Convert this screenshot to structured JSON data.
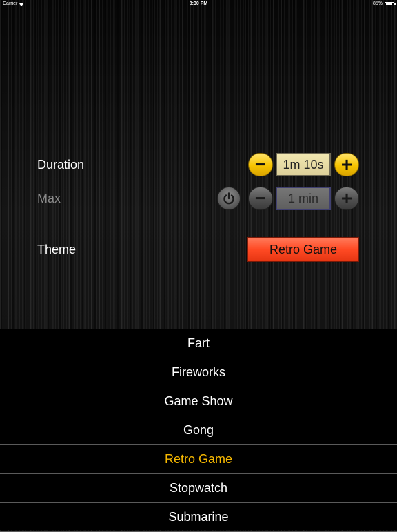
{
  "status_bar": {
    "carrier": "Carrier",
    "time": "8:30 PM",
    "battery_percent": "85%",
    "battery_level": 0.85
  },
  "settings": {
    "duration": {
      "label": "Duration",
      "value": "1m 10s",
      "minus": "−",
      "plus": "+"
    },
    "max": {
      "label": "Max",
      "value": "1 min",
      "minus": "−",
      "plus": "+",
      "power_icon": "power-icon"
    },
    "theme": {
      "label": "Theme",
      "value": "Retro Game"
    }
  },
  "theme_picker": {
    "selected": "Retro Game",
    "items": [
      "Fart",
      "Fireworks",
      "Game Show",
      "Gong",
      "Retro Game",
      "Stopwatch",
      "Submarine"
    ]
  },
  "colors": {
    "accent_yellow": "#f7c400",
    "theme_button_red": "#ff4a24",
    "selected_item": "#f6b800"
  }
}
